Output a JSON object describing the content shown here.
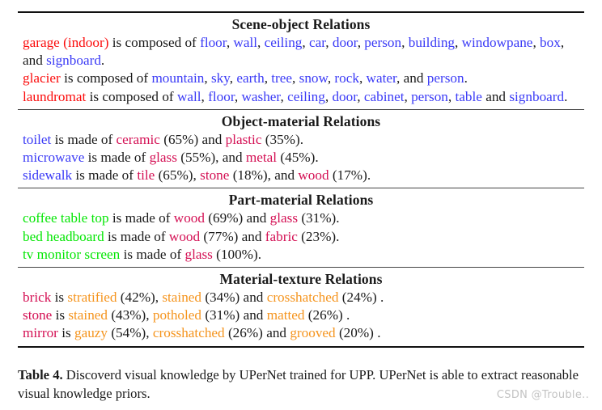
{
  "colors": {
    "scene": "#fb0d0d",
    "object": "#3b3bf6",
    "part": "#05e605",
    "material": "#d41054",
    "texture": "#f5941d",
    "plain": "#1a1a1a",
    "rule": "#111111"
  },
  "sections": [
    {
      "title": "Scene-object Relations",
      "rows": [
        {
          "tokens": [
            {
              "t": "garage (indoor)",
              "c": "scene"
            },
            {
              "t": " is composed of ",
              "c": "plain"
            },
            {
              "t": "floor",
              "c": "object"
            },
            {
              "t": ", ",
              "c": "plain"
            },
            {
              "t": "wall",
              "c": "object"
            },
            {
              "t": ", ",
              "c": "plain"
            },
            {
              "t": "ceiling",
              "c": "object"
            },
            {
              "t": ", ",
              "c": "plain"
            },
            {
              "t": "car",
              "c": "object"
            },
            {
              "t": ", ",
              "c": "plain"
            },
            {
              "t": "door",
              "c": "object"
            },
            {
              "t": ", ",
              "c": "plain"
            },
            {
              "t": "person",
              "c": "object"
            },
            {
              "t": ", ",
              "c": "plain"
            },
            {
              "t": "building",
              "c": "object"
            },
            {
              "t": ", ",
              "c": "plain"
            },
            {
              "t": "windowpane",
              "c": "object"
            },
            {
              "t": ", ",
              "c": "plain"
            },
            {
              "t": "box",
              "c": "object"
            },
            {
              "t": ", and ",
              "c": "plain"
            },
            {
              "t": "signboard",
              "c": "object"
            },
            {
              "t": ".",
              "c": "plain"
            }
          ]
        },
        {
          "tokens": [
            {
              "t": "glacier",
              "c": "scene"
            },
            {
              "t": " is composed of ",
              "c": "plain"
            },
            {
              "t": "mountain",
              "c": "object"
            },
            {
              "t": ", ",
              "c": "plain"
            },
            {
              "t": "sky",
              "c": "object"
            },
            {
              "t": ", ",
              "c": "plain"
            },
            {
              "t": "earth",
              "c": "object"
            },
            {
              "t": ", ",
              "c": "plain"
            },
            {
              "t": "tree",
              "c": "object"
            },
            {
              "t": ", ",
              "c": "plain"
            },
            {
              "t": "snow",
              "c": "object"
            },
            {
              "t": ", ",
              "c": "plain"
            },
            {
              "t": "rock",
              "c": "object"
            },
            {
              "t": ", ",
              "c": "plain"
            },
            {
              "t": "water",
              "c": "object"
            },
            {
              "t": ", and ",
              "c": "plain"
            },
            {
              "t": "person",
              "c": "object"
            },
            {
              "t": ".",
              "c": "plain"
            }
          ]
        },
        {
          "tokens": [
            {
              "t": "laundromat",
              "c": "scene"
            },
            {
              "t": " is composed of ",
              "c": "plain"
            },
            {
              "t": "wall",
              "c": "object"
            },
            {
              "t": ", ",
              "c": "plain"
            },
            {
              "t": "floor",
              "c": "object"
            },
            {
              "t": ", ",
              "c": "plain"
            },
            {
              "t": "washer",
              "c": "object"
            },
            {
              "t": ", ",
              "c": "plain"
            },
            {
              "t": "ceiling",
              "c": "object"
            },
            {
              "t": ", ",
              "c": "plain"
            },
            {
              "t": "door",
              "c": "object"
            },
            {
              "t": ", ",
              "c": "plain"
            },
            {
              "t": "cabinet",
              "c": "object"
            },
            {
              "t": ", ",
              "c": "plain"
            },
            {
              "t": "person",
              "c": "object"
            },
            {
              "t": ", ",
              "c": "plain"
            },
            {
              "t": "table",
              "c": "object"
            },
            {
              "t": " and ",
              "c": "plain"
            },
            {
              "t": "signboard",
              "c": "object"
            },
            {
              "t": ".",
              "c": "plain"
            }
          ]
        }
      ]
    },
    {
      "title": "Object-material Relations",
      "rows": [
        {
          "tokens": [
            {
              "t": "toilet",
              "c": "object"
            },
            {
              "t": " is made of ",
              "c": "plain"
            },
            {
              "t": "ceramic",
              "c": "material"
            },
            {
              "t": " (65%) and ",
              "c": "plain"
            },
            {
              "t": "plastic",
              "c": "material"
            },
            {
              "t": " (35%).",
              "c": "plain"
            }
          ]
        },
        {
          "tokens": [
            {
              "t": "microwave",
              "c": "object"
            },
            {
              "t": " is made of ",
              "c": "plain"
            },
            {
              "t": "glass",
              "c": "material"
            },
            {
              "t": " (55%), and ",
              "c": "plain"
            },
            {
              "t": "metal",
              "c": "material"
            },
            {
              "t": " (45%).",
              "c": "plain"
            }
          ]
        },
        {
          "tokens": [
            {
              "t": "sidewalk",
              "c": "object"
            },
            {
              "t": " is made of ",
              "c": "plain"
            },
            {
              "t": "tile",
              "c": "material"
            },
            {
              "t": " (65%), ",
              "c": "plain"
            },
            {
              "t": "stone",
              "c": "material"
            },
            {
              "t": " (18%), and ",
              "c": "plain"
            },
            {
              "t": "wood",
              "c": "material"
            },
            {
              "t": " (17%).",
              "c": "plain"
            }
          ]
        }
      ]
    },
    {
      "title": "Part-material Relations",
      "rows": [
        {
          "tokens": [
            {
              "t": "coffee table top",
              "c": "part"
            },
            {
              "t": " is made of ",
              "c": "plain"
            },
            {
              "t": "wood",
              "c": "material"
            },
            {
              "t": " (69%) and ",
              "c": "plain"
            },
            {
              "t": "glass",
              "c": "material"
            },
            {
              "t": " (31%).",
              "c": "plain"
            }
          ]
        },
        {
          "tokens": [
            {
              "t": "bed headboard",
              "c": "part"
            },
            {
              "t": " is made of ",
              "c": "plain"
            },
            {
              "t": "wood",
              "c": "material"
            },
            {
              "t": " (77%) and ",
              "c": "plain"
            },
            {
              "t": "fabric",
              "c": "material"
            },
            {
              "t": " (23%).",
              "c": "plain"
            }
          ]
        },
        {
          "tokens": [
            {
              "t": "tv monitor screen",
              "c": "part"
            },
            {
              "t": " is made of ",
              "c": "plain"
            },
            {
              "t": "glass",
              "c": "material"
            },
            {
              "t": " (100%).",
              "c": "plain"
            }
          ]
        }
      ]
    },
    {
      "title": "Material-texture Relations",
      "rows": [
        {
          "tokens": [
            {
              "t": "brick",
              "c": "material"
            },
            {
              "t": " is ",
              "c": "plain"
            },
            {
              "t": "stratified",
              "c": "texture"
            },
            {
              "t": " (42%), ",
              "c": "plain"
            },
            {
              "t": "stained",
              "c": "texture"
            },
            {
              "t": " (34%) and ",
              "c": "plain"
            },
            {
              "t": "crosshatched",
              "c": "texture"
            },
            {
              "t": " (24%) .",
              "c": "plain"
            }
          ]
        },
        {
          "tokens": [
            {
              "t": "stone",
              "c": "material"
            },
            {
              "t": " is ",
              "c": "plain"
            },
            {
              "t": "stained",
              "c": "texture"
            },
            {
              "t": " (43%), ",
              "c": "plain"
            },
            {
              "t": "potholed",
              "c": "texture"
            },
            {
              "t": " (31%) and ",
              "c": "plain"
            },
            {
              "t": "matted",
              "c": "texture"
            },
            {
              "t": " (26%) .",
              "c": "plain"
            }
          ]
        },
        {
          "tokens": [
            {
              "t": "mirror",
              "c": "material"
            },
            {
              "t": " is ",
              "c": "plain"
            },
            {
              "t": "gauzy",
              "c": "texture"
            },
            {
              "t": " (54%), ",
              "c": "plain"
            },
            {
              "t": "crosshatched",
              "c": "texture"
            },
            {
              "t": " (26%) and ",
              "c": "plain"
            },
            {
              "t": "grooved",
              "c": "texture"
            },
            {
              "t": " (20%) .",
              "c": "plain"
            }
          ]
        }
      ]
    }
  ],
  "caption": {
    "label": "Table 4.",
    "text": " Discoverd visual knowledge by UPerNet trained for UPP. UPerNet is able to extract reasonable visual knowledge priors."
  },
  "watermark": "CSDN @Trouble.."
}
